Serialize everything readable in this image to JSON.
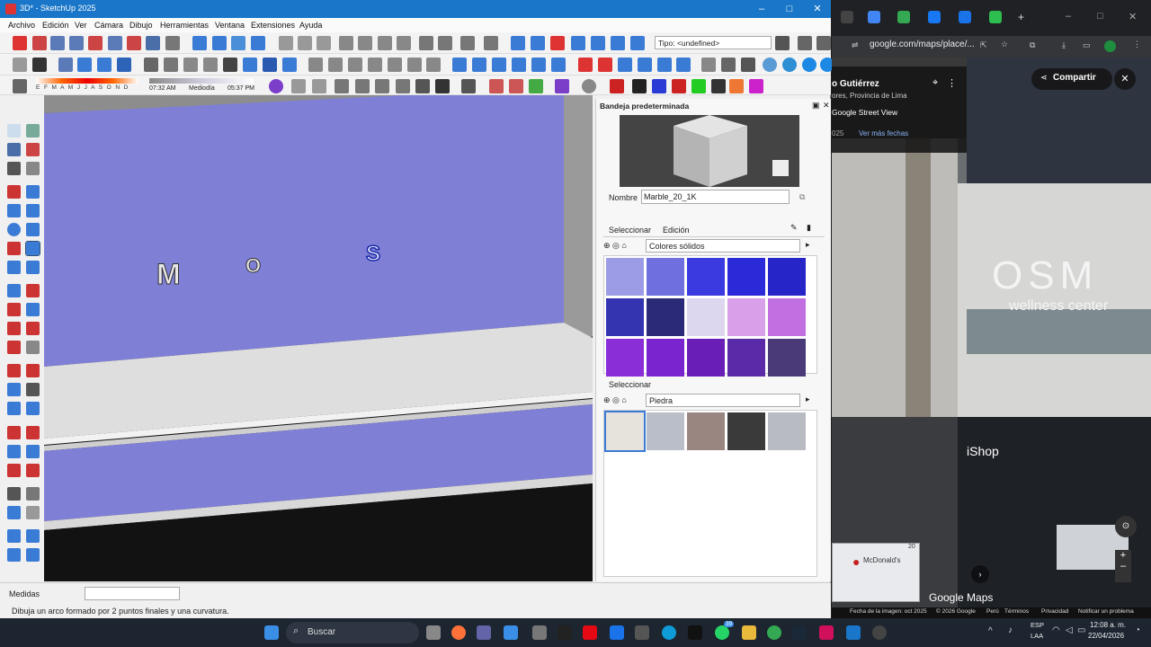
{
  "sketchup": {
    "title": "3D* - SketchUp 2025",
    "menu": [
      "Archivo",
      "Edición",
      "Ver",
      "Cámara",
      "Dibujo",
      "Herramientas",
      "Ventana",
      "Extensiones",
      "Ayuda"
    ],
    "tipo_field": "Tipo: <undefined>",
    "shadow": {
      "months": "E F M A M J J A S O N D",
      "time_start": "07:32 AM",
      "time_mid": "Mediodía",
      "time_end": "05:37 PM"
    },
    "viewport_letters": [
      "M",
      "O",
      "S"
    ],
    "tray": {
      "title": "Bandeja predeterminada",
      "name_label": "Nombre",
      "name_value": "Marble_20_1K",
      "tab_select": "Seleccionar",
      "tab_edit": "Edición",
      "library1": "Colores sólidos",
      "select2": "Seleccionar",
      "library2": "Piedra"
    },
    "status": {
      "measures_label": "Medidas",
      "hint": "Dibuja un arco formado por 2 puntos finales y una curvatura."
    }
  },
  "chrome": {
    "url": "google.com/maps/place/...",
    "share": "Compartir",
    "place_title": "o Gutiérrez",
    "place_sub": "ores, Provincia de Lima",
    "street_view": "Google Street View",
    "year": "025",
    "more_dates": "Ver más fechas",
    "sign_main": "OSM",
    "sign_sub": "wellness center",
    "ishop": "iShop",
    "minimap_place": "McDonald's",
    "minimap_scale": "20",
    "brand": "Google Maps",
    "footer": {
      "date": "Fecha de la imagen: oct 2025",
      "copy": "© 2026 Google",
      "country": "Perú",
      "terms": "Términos",
      "privacy": "Privacidad",
      "report": "Notificar un problema"
    }
  },
  "taskbar": {
    "search": "Buscar",
    "lang1": "ESP",
    "lang2": "LAA",
    "time": "12:08 a. m.",
    "date": "22/04/2026",
    "badge": "39"
  },
  "colors": {
    "titlebar": "#1976c8",
    "wall": "#7f7fd6",
    "taskbar": "#1c2530"
  }
}
